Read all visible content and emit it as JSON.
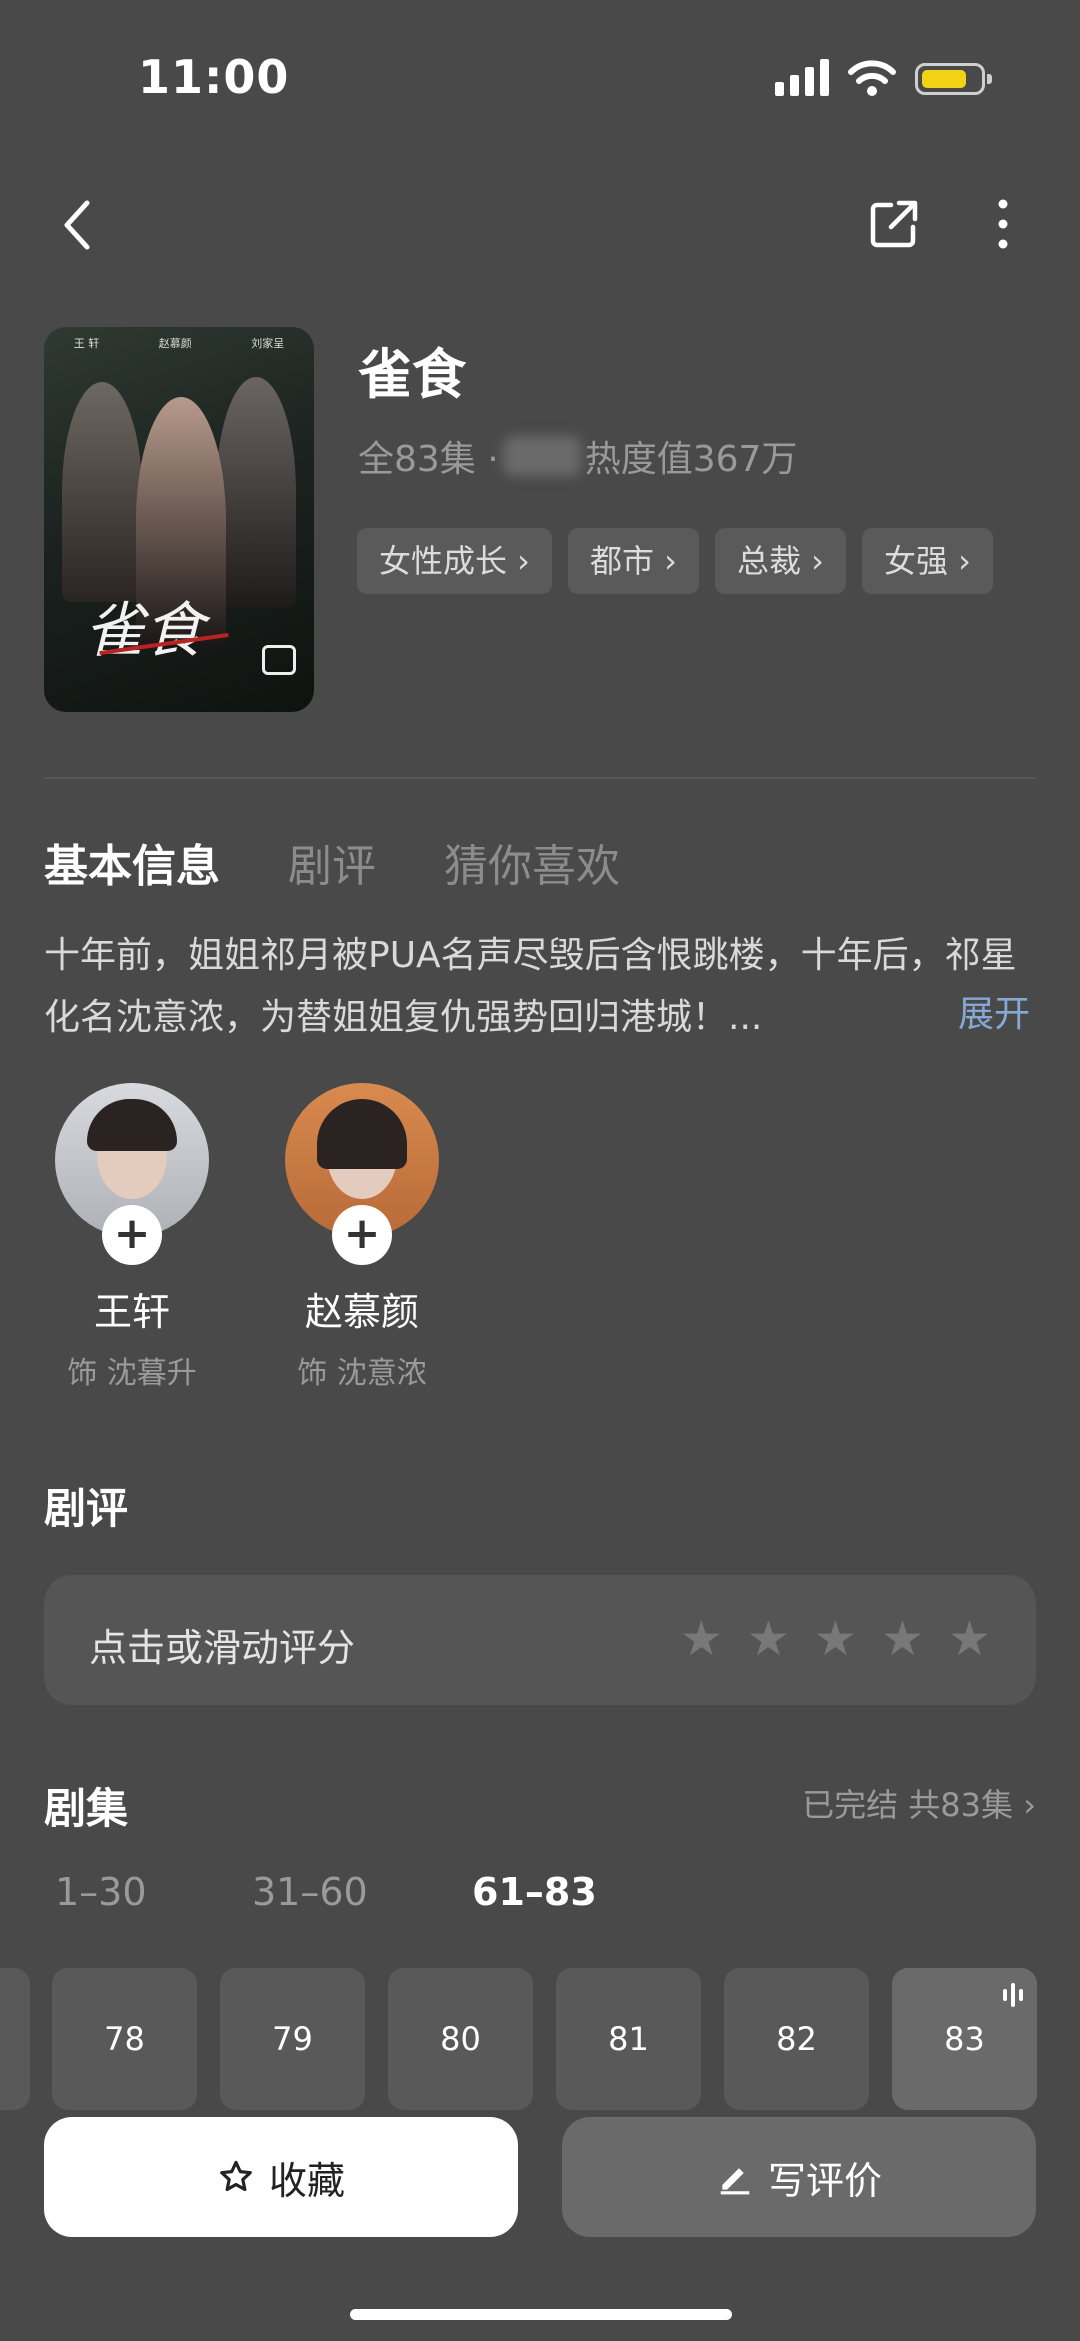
{
  "status": {
    "time": "11:00"
  },
  "show": {
    "title": "雀食",
    "episodes_text": "全83集 ·",
    "heat_text": "热度值367万",
    "tags": [
      "女性成长 ›",
      "都市 ›",
      "总裁 ›",
      "女强 ›"
    ],
    "poster": {
      "title_art": "雀食",
      "cast_names": [
        "王 轩",
        "赵慕颜",
        "刘家呈"
      ]
    }
  },
  "tabs": [
    "基本信息",
    "剧评",
    "猜你喜欢"
  ],
  "synopsis": "十年前，姐姐祁月被PUA名声尽毁后含恨跳楼，十年后，祁星化名沈意浓，为替姐姐复仇强势回归港城！...",
  "expand_label": "展开",
  "cast": [
    {
      "name": "王轩",
      "role": "饰 沈暮升"
    },
    {
      "name": "赵慕颜",
      "role": "饰 沈意浓"
    }
  ],
  "review": {
    "title": "剧评",
    "prompt": "点击或滑动评分",
    "stars": 5
  },
  "episodes": {
    "title": "剧集",
    "status": "已完结 共83集 ›",
    "ranges": [
      "1–30",
      "31–60",
      "61–83"
    ],
    "active_range": "61–83",
    "items": [
      "78",
      "79",
      "80",
      "81",
      "82",
      "83"
    ],
    "playing": "83"
  },
  "actions": {
    "favorite": "收藏",
    "write_review": "写评价"
  }
}
